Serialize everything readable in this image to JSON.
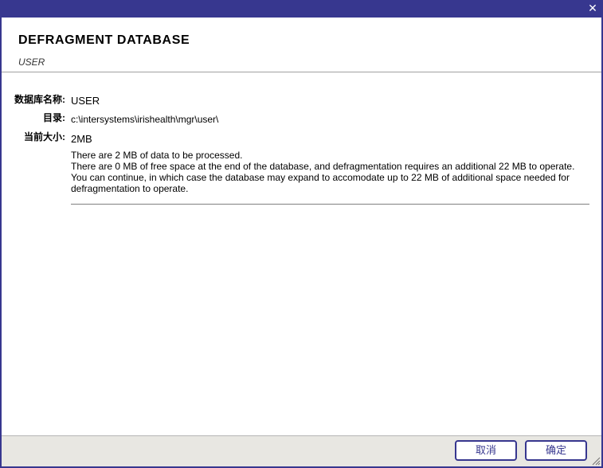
{
  "dialog": {
    "close_symbol": "✕",
    "title": "DEFRAGMENT DATABASE",
    "subtitle": "USER"
  },
  "details": {
    "db_name_label": "数据库名称:",
    "db_name_value": "USER",
    "directory_label": "目录:",
    "directory_value": "c:\\intersystems\\irishealth\\mgr\\user\\",
    "current_size_label": "当前大小:",
    "current_size_value": "2MB"
  },
  "message": {
    "line1": "There are 2 MB of data to be processed.",
    "line2": "There are 0 MB of free space at the end of the database, and defragmentation requires an additional 22 MB to operate.",
    "line3": "You can continue, in which case the database may expand to accomodate up to 22 MB of additional space needed for",
    "line4": "defragmentation to operate."
  },
  "buttons": {
    "cancel_label": "取消",
    "ok_label": "确定"
  },
  "icons": {
    "close": "close-icon",
    "resize": "resize-grip-icon"
  },
  "colors": {
    "accent": "#37378f",
    "footer_bg": "#e8e7e2"
  }
}
